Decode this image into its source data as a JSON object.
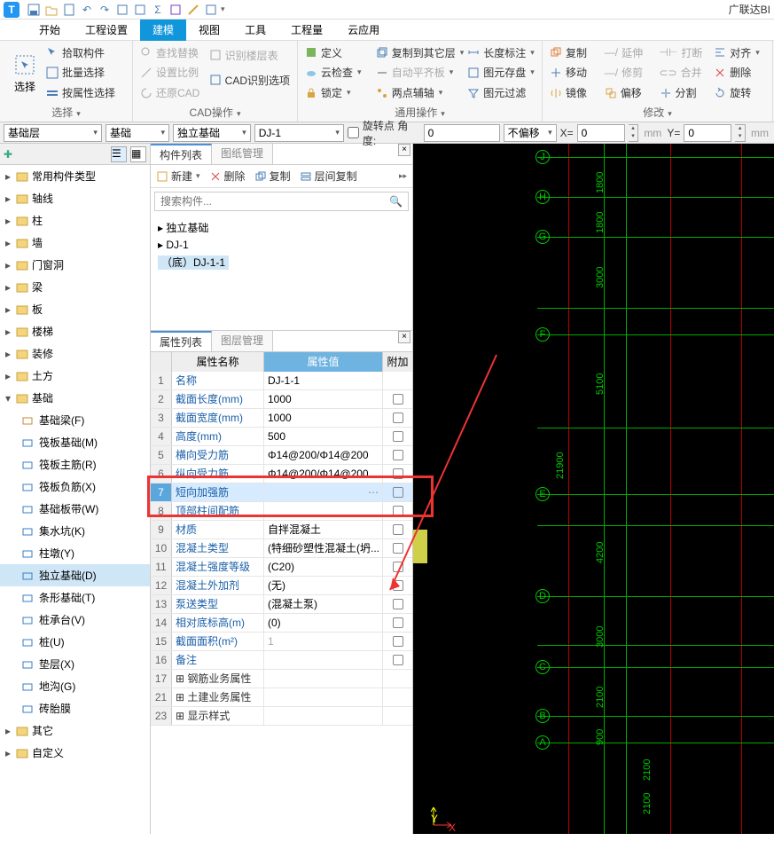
{
  "brand": "广联达BI",
  "menus": [
    "开始",
    "工程设置",
    "建模",
    "视图",
    "工具",
    "工程量",
    "云应用"
  ],
  "ribbon": {
    "select": {
      "big": "选择",
      "items": [
        "拾取构件",
        "批量选择",
        "按属性选择"
      ],
      "label": "选择"
    },
    "cad": {
      "items": [
        [
          "查找替换",
          "识别楼层表"
        ],
        [
          "设置比例",
          "CAD识别选项"
        ],
        [
          "还原CAD",
          ""
        ]
      ],
      "label": "CAD操作"
    },
    "general": {
      "items": [
        [
          "定义",
          "复制到其它层",
          "长度标注"
        ],
        [
          "云检查",
          "自动平齐板",
          "图元存盘"
        ],
        [
          "锁定",
          "两点辅轴",
          "图元过滤"
        ]
      ],
      "label": "通用操作"
    },
    "modify": {
      "items": [
        [
          "复制",
          "延伸",
          "打断",
          "对齐"
        ],
        [
          "移动",
          "修剪",
          "合并",
          "删除"
        ],
        [
          "镜像",
          "偏移",
          "分割",
          "旋转"
        ]
      ],
      "label": "修改"
    }
  },
  "selectors": {
    "layer": "基础层",
    "cat": "基础",
    "type": "独立基础",
    "inst": "DJ-1",
    "rot_label": "旋转点  角度:",
    "rot_val": "0",
    "offset": "不偏移",
    "x_label": "X=",
    "x_val": "0",
    "y_label": "Y=",
    "y_val": "0",
    "unit": "mm"
  },
  "nav": {
    "groups": [
      {
        "label": "常用构件类型",
        "items": []
      },
      {
        "label": "轴线",
        "items": []
      },
      {
        "label": "柱",
        "items": []
      },
      {
        "label": "墙",
        "items": []
      },
      {
        "label": "门窗洞",
        "items": []
      },
      {
        "label": "梁",
        "items": []
      },
      {
        "label": "板",
        "items": []
      },
      {
        "label": "楼梯",
        "items": []
      },
      {
        "label": "装修",
        "items": []
      },
      {
        "label": "土方",
        "items": []
      },
      {
        "label": "基础",
        "open": true,
        "items": [
          {
            "label": "基础梁(F)",
            "ico": "#c58b3a"
          },
          {
            "label": "筏板基础(M)",
            "ico": "#3a7ec5"
          },
          {
            "label": "筏板主筋(R)",
            "ico": "#3a7ec5"
          },
          {
            "label": "筏板负筋(X)",
            "ico": "#3a7ec5"
          },
          {
            "label": "基础板带(W)",
            "ico": "#3a7ec5"
          },
          {
            "label": "集水坑(K)",
            "ico": "#3a7ec5"
          },
          {
            "label": "柱墩(Y)",
            "ico": "#3a7ec5"
          },
          {
            "label": "独立基础(D)",
            "ico": "#3a7ec5",
            "active": true
          },
          {
            "label": "条形基础(T)",
            "ico": "#3a7ec5"
          },
          {
            "label": "桩承台(V)",
            "ico": "#3a7ec5"
          },
          {
            "label": "桩(U)",
            "ico": "#3a7ec5"
          },
          {
            "label": "垫层(X)",
            "ico": "#3a7ec5"
          },
          {
            "label": "地沟(G)",
            "ico": "#3a7ec5"
          },
          {
            "label": "砖胎膜",
            "ico": "#3a7ec5"
          }
        ]
      },
      {
        "label": "其它",
        "items": []
      },
      {
        "label": "自定义",
        "items": []
      }
    ]
  },
  "mid": {
    "tabs": [
      "构件列表",
      "图纸管理"
    ],
    "toolbar": [
      "新建",
      "删除",
      "复制",
      "层间复制"
    ],
    "search_ph": "搜索构件...",
    "tree": {
      "root": "独立基础",
      "child": "DJ-1",
      "leaf": "（底）DJ-1-1"
    }
  },
  "prop": {
    "tabs": [
      "属性列表",
      "图层管理"
    ],
    "head": {
      "name": "属性名称",
      "val": "属性值",
      "extra": "附加"
    },
    "rows": [
      {
        "n": "1",
        "name": "名称",
        "val": "DJ-1-1",
        "chk": false
      },
      {
        "n": "2",
        "name": "截面长度(mm)",
        "val": "1000",
        "chk": true
      },
      {
        "n": "3",
        "name": "截面宽度(mm)",
        "val": "1000",
        "chk": true
      },
      {
        "n": "4",
        "name": "高度(mm)",
        "val": "500",
        "chk": true
      },
      {
        "n": "5",
        "name": "横向受力筋",
        "val": "Φ14@200/Φ14@200",
        "chk": true,
        "hl": true
      },
      {
        "n": "6",
        "name": "纵向受力筋",
        "val": "Φ14@200/Φ14@200",
        "chk": true,
        "hl": true
      },
      {
        "n": "7",
        "name": "短向加强筋",
        "val": "",
        "chk": true,
        "sel": true
      },
      {
        "n": "8",
        "name": "顶部柱间配筋",
        "val": "",
        "chk": true
      },
      {
        "n": "9",
        "name": "材质",
        "val": "自拌混凝土",
        "chk": true
      },
      {
        "n": "10",
        "name": "混凝土类型",
        "val": "(特细砂塑性混凝土(坍...",
        "chk": true
      },
      {
        "n": "11",
        "name": "混凝土强度等级",
        "val": "(C20)",
        "chk": true
      },
      {
        "n": "12",
        "name": "混凝土外加剂",
        "val": "(无)",
        "chk": true
      },
      {
        "n": "13",
        "name": "泵送类型",
        "val": "(混凝土泵)",
        "chk": true
      },
      {
        "n": "14",
        "name": "相对底标高(m)",
        "val": "(0)",
        "chk": true
      },
      {
        "n": "15",
        "name": "截面面积(m²)",
        "val": "1",
        "chk": true,
        "gray": true
      },
      {
        "n": "16",
        "name": "备注",
        "val": "",
        "chk": true
      },
      {
        "n": "17",
        "name": "钢筋业务属性",
        "val": "",
        "expand": true
      },
      {
        "n": "21",
        "name": "土建业务属性",
        "val": "",
        "expand": true
      },
      {
        "n": "23",
        "name": "显示样式",
        "val": "",
        "expand": true
      }
    ]
  },
  "canvas": {
    "labels": [
      "J",
      "H",
      "G",
      "F",
      "E",
      "D",
      "C",
      "B",
      "A"
    ],
    "dims": [
      "1800",
      "1800",
      "3000",
      "5100",
      "21900",
      "4200",
      "3000",
      "2100",
      "900",
      "2100",
      "2100"
    ],
    "coord": {
      "y": "Y",
      "x": "X"
    }
  }
}
